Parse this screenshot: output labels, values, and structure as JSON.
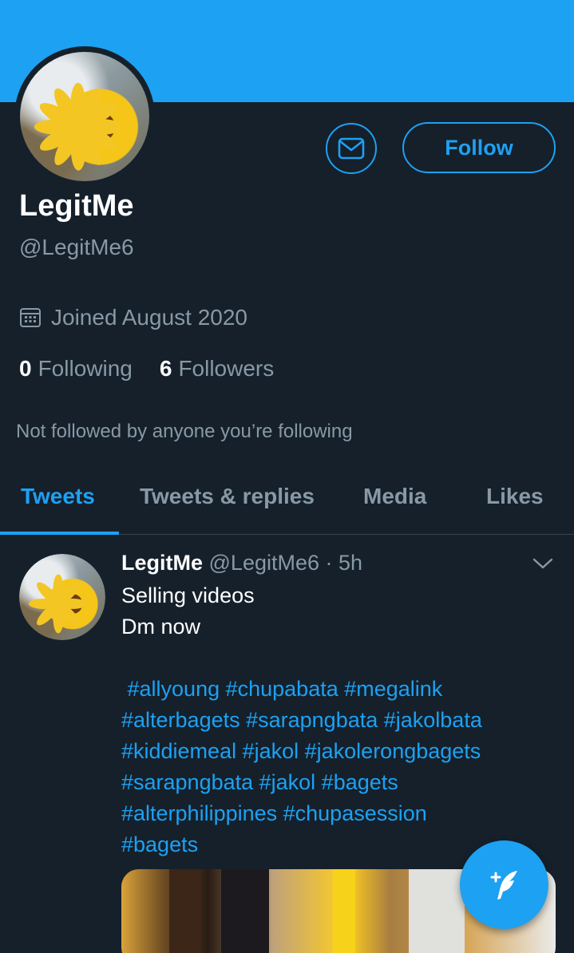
{
  "profile": {
    "display_name": "LegitMe",
    "handle": "@LegitMe6",
    "joined": "Joined August 2020",
    "following_count": "0",
    "following_label": "Following",
    "followers_count": "6",
    "followers_label": "Followers",
    "not_followed": "Not followed by anyone you’re following"
  },
  "actions": {
    "follow_label": "Follow",
    "message_icon": "envelope-icon"
  },
  "tabs": [
    {
      "label": "Tweets",
      "active": true
    },
    {
      "label": "Tweets & replies",
      "active": false
    },
    {
      "label": "Media",
      "active": false
    },
    {
      "label": "Likes",
      "active": false
    }
  ],
  "tweet": {
    "name": "LegitMe",
    "meta": " @LegitMe6 · 5h",
    "line1": "Selling videos",
    "line2": "Dm now",
    "hashtags": [
      " #allyoung #chupabata #megalink",
      "#alterbagets #sarapngbata #jakolbata",
      "#kiddiemeal #jakol #jakolerongbagets",
      "#sarapngbata #jakol #bagets",
      "#alterphilippines #chupasession",
      "#bagets"
    ]
  },
  "fab": {
    "icon": "compose-tweet-icon"
  },
  "colors": {
    "background": "#15202b",
    "accent": "#1da1f2",
    "secondary_text": "#8899a6",
    "divider": "#38444d"
  }
}
